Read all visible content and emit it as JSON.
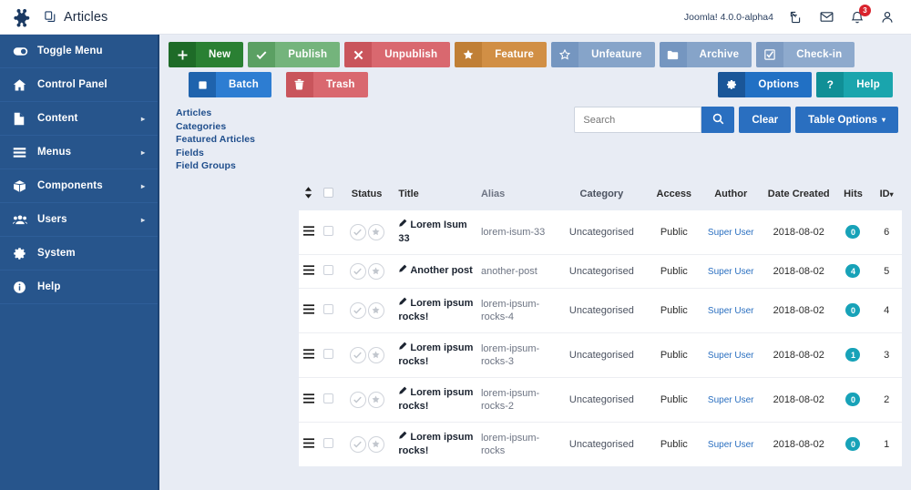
{
  "header": {
    "brand_icon": "joomla-logo",
    "title_icon": "articles-copy-icon",
    "title": "Articles",
    "version": "Joomla! 4.0.0-alpha4",
    "icons": [
      {
        "name": "external-link-icon"
      },
      {
        "name": "mail-icon"
      },
      {
        "name": "bell-icon",
        "badge": "3"
      },
      {
        "name": "user-icon"
      }
    ]
  },
  "sidebar": {
    "items": [
      {
        "label": "Toggle Menu",
        "icon": "toggle-icon",
        "caret": ""
      },
      {
        "label": "Control Panel",
        "icon": "home-icon",
        "caret": ""
      },
      {
        "label": "Content",
        "icon": "document-icon",
        "caret": "▸"
      },
      {
        "label": "Menus",
        "icon": "list-icon",
        "caret": "▸"
      },
      {
        "label": "Components",
        "icon": "cube-icon",
        "caret": "▸"
      },
      {
        "label": "Users",
        "icon": "users-icon",
        "caret": "▸"
      },
      {
        "label": "System",
        "icon": "gear-icon",
        "caret": ""
      },
      {
        "label": "Help",
        "icon": "info-icon",
        "caret": ""
      }
    ]
  },
  "toolbar": {
    "row1": [
      {
        "label": "New",
        "icon": "plus-icon",
        "cls": "tb-new"
      },
      {
        "label": "Publish",
        "icon": "check-icon",
        "cls": "tb-pub"
      },
      {
        "label": "Unpublish",
        "icon": "times-icon",
        "cls": "tb-unp"
      },
      {
        "label": "Feature",
        "icon": "star-filled-icon",
        "cls": "tb-fea"
      },
      {
        "label": "Unfeature",
        "icon": "star-outline-icon",
        "cls": "tb-unf"
      },
      {
        "label": "Archive",
        "icon": "folder-icon",
        "cls": "tb-arc"
      },
      {
        "label": "Check-in",
        "icon": "checkbox-icon",
        "cls": "tb-chk"
      }
    ],
    "row2": [
      {
        "label": "Batch",
        "icon": "square-icon",
        "cls": "tb-bat"
      },
      {
        "label": "Trash",
        "icon": "trash-icon",
        "cls": "tb-tra"
      }
    ],
    "row2right": [
      {
        "label": "Options",
        "icon": "gear-icon",
        "cls": "tb-opt"
      },
      {
        "label": "Help",
        "icon": "question-icon",
        "cls": "tb-hlp"
      }
    ]
  },
  "subnav": {
    "items": [
      {
        "label": "Articles"
      },
      {
        "label": "Categories"
      },
      {
        "label": "Featured Articles"
      },
      {
        "label": "Fields"
      },
      {
        "label": "Field Groups"
      }
    ]
  },
  "search": {
    "placeholder": "Search",
    "value": "",
    "search_icon": "search-icon",
    "clear_label": "Clear",
    "table_options_label": "Table Options",
    "table_options_caret": "▾"
  },
  "table": {
    "headers": {
      "sort": "↕",
      "status": "Status",
      "title": "Title",
      "alias": "Alias",
      "category": "Category",
      "access": "Access",
      "author": "Author",
      "date_created": "Date Created",
      "hits": "Hits",
      "id": "ID",
      "id_caret": "▾"
    },
    "rows": [
      {
        "title": "Lorem Isum 33",
        "alias": "lorem-isum-33",
        "category": "Uncategorised",
        "access": "Public",
        "author": "Super User",
        "date": "2018-08-02",
        "hits": "0",
        "id": "6"
      },
      {
        "title": "Another post",
        "alias": "another-post",
        "category": "Uncategorised",
        "access": "Public",
        "author": "Super User",
        "date": "2018-08-02",
        "hits": "4",
        "id": "5"
      },
      {
        "title": "Lorem ipsum rocks!",
        "alias": "lorem-ipsum-rocks-4",
        "category": "Uncategorised",
        "access": "Public",
        "author": "Super User",
        "date": "2018-08-02",
        "hits": "0",
        "id": "4"
      },
      {
        "title": "Lorem ipsum rocks!",
        "alias": "lorem-ipsum-rocks-3",
        "category": "Uncategorised",
        "access": "Public",
        "author": "Super User",
        "date": "2018-08-02",
        "hits": "1",
        "id": "3"
      },
      {
        "title": "Lorem ipsum rocks!",
        "alias": "lorem-ipsum-rocks-2",
        "category": "Uncategorised",
        "access": "Public",
        "author": "Super User",
        "date": "2018-08-02",
        "hits": "0",
        "id": "2"
      },
      {
        "title": "Lorem ipsum rocks!",
        "alias": "lorem-ipsum-rocks",
        "category": "Uncategorised",
        "access": "Public",
        "author": "Super User",
        "date": "2018-08-02",
        "hits": "0",
        "id": "1"
      }
    ]
  },
  "colors": {
    "sidebar": "#27558c",
    "content_bg": "#e8ecf4",
    "accent_blue": "#2a6fc0",
    "badge_red": "#d9232d",
    "hits_teal": "#17a2b8"
  }
}
